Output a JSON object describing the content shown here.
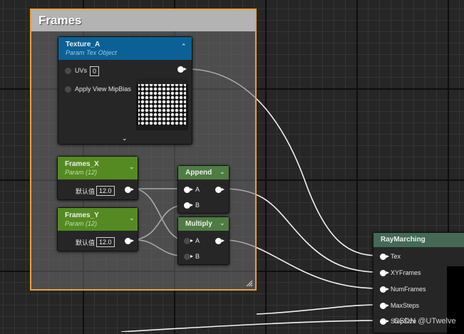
{
  "comment_box": {
    "title": "Frames"
  },
  "texture_node": {
    "title": "Texture_A",
    "subtitle": "Param Tex Object",
    "pins": {
      "uvs": "UVs",
      "uvs_value": "0",
      "mip_bias": "Apply View MipBias"
    },
    "header_color": "#0b6196"
  },
  "frames_x_node": {
    "title": "Frames_X",
    "subtitle": "Param (12)",
    "value_label": "默认值",
    "value": "12.0",
    "header_color": "#558a22"
  },
  "frames_y_node": {
    "title": "Frames_Y",
    "subtitle": "Param (12)",
    "value_label": "默认值",
    "value": "12.0",
    "header_color": "#558a22"
  },
  "append_node": {
    "title": "Append",
    "pin_a": "A",
    "pin_b": "B",
    "header_color": "#4f7c42"
  },
  "multiply_node": {
    "title": "Multiply",
    "pin_a": "A",
    "pin_b": "B",
    "header_color": "#4f7c42"
  },
  "raymarching_node": {
    "title": "RayMarching",
    "pins": [
      "Tex",
      "XYFrames",
      "NumFrames",
      "MaxSteps",
      "StepSize"
    ]
  },
  "watermark": "CSDN @UTwelve"
}
